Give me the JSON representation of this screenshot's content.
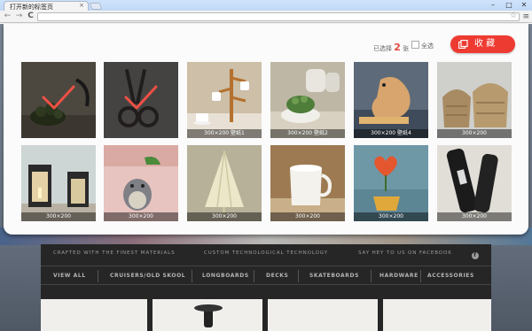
{
  "browser": {
    "tab_title": "打开新的标签页",
    "tab_close": "×",
    "window_controls": {
      "minimize": "–",
      "restore": "□",
      "close": "✕"
    },
    "nav": {
      "back": "←",
      "forward": "→",
      "reload": "C"
    },
    "address_value": "",
    "star": "☆",
    "menu": "≡"
  },
  "panel": {
    "selected_prefix": "已选择",
    "selected_count": "2",
    "selected_suffix": "张",
    "select_all_label": "全选",
    "collect_button_label": "收 藏",
    "accent_color": "#ee3b32",
    "images": [
      {
        "caption": "",
        "subject": "succulent-plant",
        "selected": true
      },
      {
        "caption": "",
        "subject": "scissors",
        "selected": true
      },
      {
        "caption": "300×200 壁纸1",
        "subject": "mug-tree",
        "selected": false
      },
      {
        "caption": "300×200 壁纸2",
        "subject": "potted-plant-and-jars",
        "selected": false
      },
      {
        "caption": "300×200 壁纸4",
        "subject": "wooden-bird",
        "selected": false
      },
      {
        "caption": "300×200",
        "subject": "wicker-baskets",
        "selected": false
      },
      {
        "caption": "300×200",
        "subject": "lanterns",
        "selected": false
      },
      {
        "caption": "300×200",
        "subject": "totoro-figurine",
        "selected": false
      },
      {
        "caption": "300×200",
        "subject": "umbrella",
        "selected": false
      },
      {
        "caption": "300×200",
        "subject": "milk-glass",
        "selected": false
      },
      {
        "caption": "300×200",
        "subject": "heart-plant",
        "selected": false
      },
      {
        "caption": "300×200",
        "subject": "black-umbrella",
        "selected": false
      }
    ]
  },
  "background_page": {
    "tagline_1": "CRAFTED WITH THE FINEST MATERIALS",
    "tagline_2": "CUSTOM TECHNOLOGICAL TECHNOLOGY",
    "tagline_3": "SAY HEY TO US ON FACEBOOK",
    "facebook_icon": "f",
    "nav_items": [
      "VIEW ALL",
      "CRUISERS/OLD SKOOL",
      "LONGBOARDS",
      "DECKS",
      "SKATEBOARDS",
      "HARDWARE",
      "ACCESSORIES"
    ]
  }
}
